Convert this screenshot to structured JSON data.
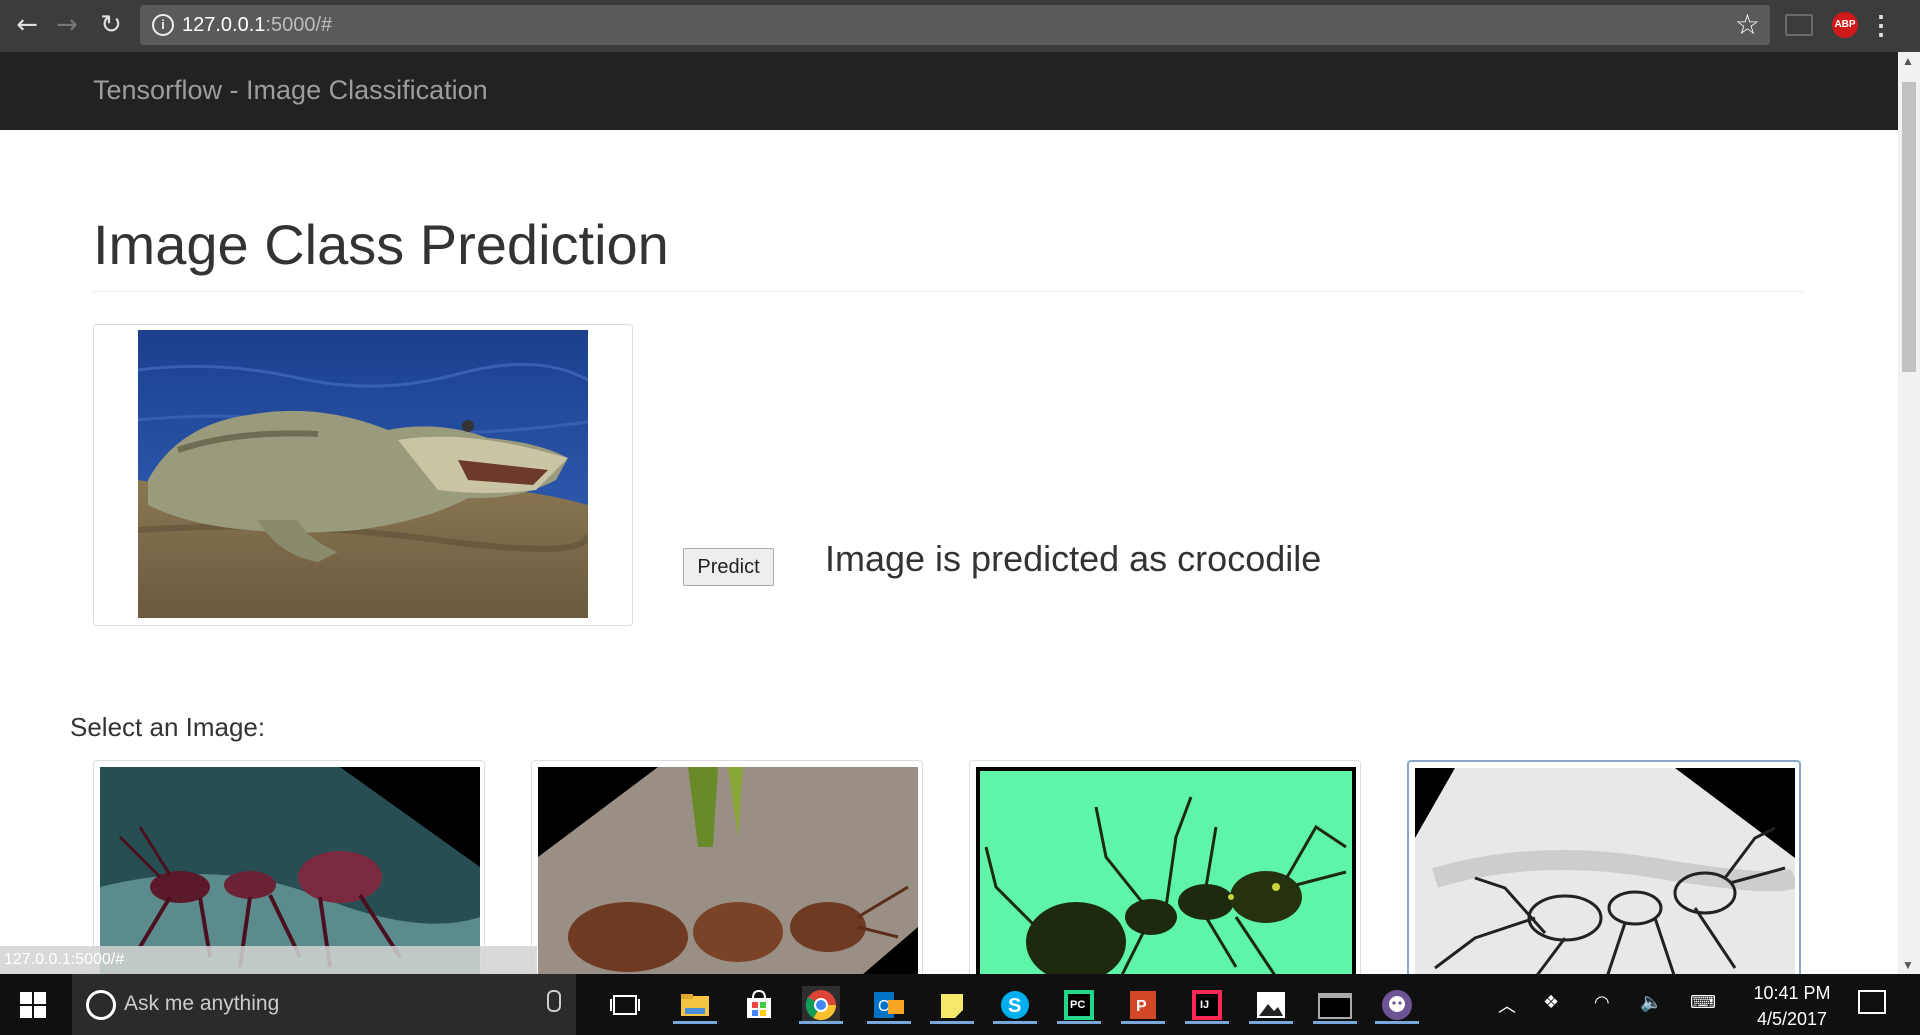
{
  "browser": {
    "url_host": "127.0.0.1",
    "url_rest": ":5000/#",
    "back_label": "←",
    "forward_label": "→",
    "reload_label": "↻",
    "star_label": "☆",
    "abp_label": "ABP",
    "menu_label": "⋮"
  },
  "navbar": {
    "brand": "Tensorflow - Image Classification"
  },
  "main": {
    "title": "Image Class Prediction",
    "predict_label": "Predict",
    "prediction_text": "Image is predicted as crocodile",
    "select_label": "Select an Image:"
  },
  "status_bar": {
    "url": "127.0.0.1:5000/#"
  },
  "taskbar": {
    "search_placeholder": "Ask me anything",
    "time": "10:41 PM",
    "date": "4/5/2017"
  },
  "colors": {
    "navbar_bg": "#222222",
    "brand_text": "#9d9d9d",
    "taskbar_bg": "#101010"
  }
}
